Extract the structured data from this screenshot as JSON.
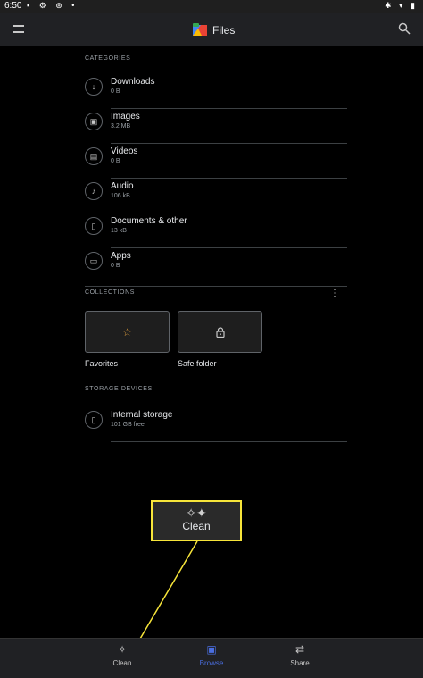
{
  "status_bar": {
    "time": "6:50"
  },
  "app": {
    "title": "Files"
  },
  "categories": {
    "label": "CATEGORIES",
    "items": [
      {
        "name": "Downloads",
        "size": "0 B",
        "icon": "download-icon"
      },
      {
        "name": "Images",
        "size": "3.2 MB",
        "icon": "image-icon"
      },
      {
        "name": "Videos",
        "size": "0 B",
        "icon": "video-icon"
      },
      {
        "name": "Audio",
        "size": "106 kB",
        "icon": "music-note-icon"
      },
      {
        "name": "Documents & other",
        "size": "13 kB",
        "icon": "document-icon"
      },
      {
        "name": "Apps",
        "size": "0 B",
        "icon": "apps-icon"
      }
    ]
  },
  "collections": {
    "label": "COLLECTIONS",
    "favorites": "Favorites",
    "safe_folder": "Safe folder"
  },
  "storage": {
    "label": "STORAGE DEVICES",
    "internal_name": "Internal storage",
    "internal_free": "101 GB free"
  },
  "callout": {
    "label": "Clean",
    "color": "#f7e53a"
  },
  "bottom_nav": {
    "clean": "Clean",
    "browse": "Browse",
    "share": "Share",
    "active": "Browse",
    "active_color": "#4a6ee0"
  }
}
